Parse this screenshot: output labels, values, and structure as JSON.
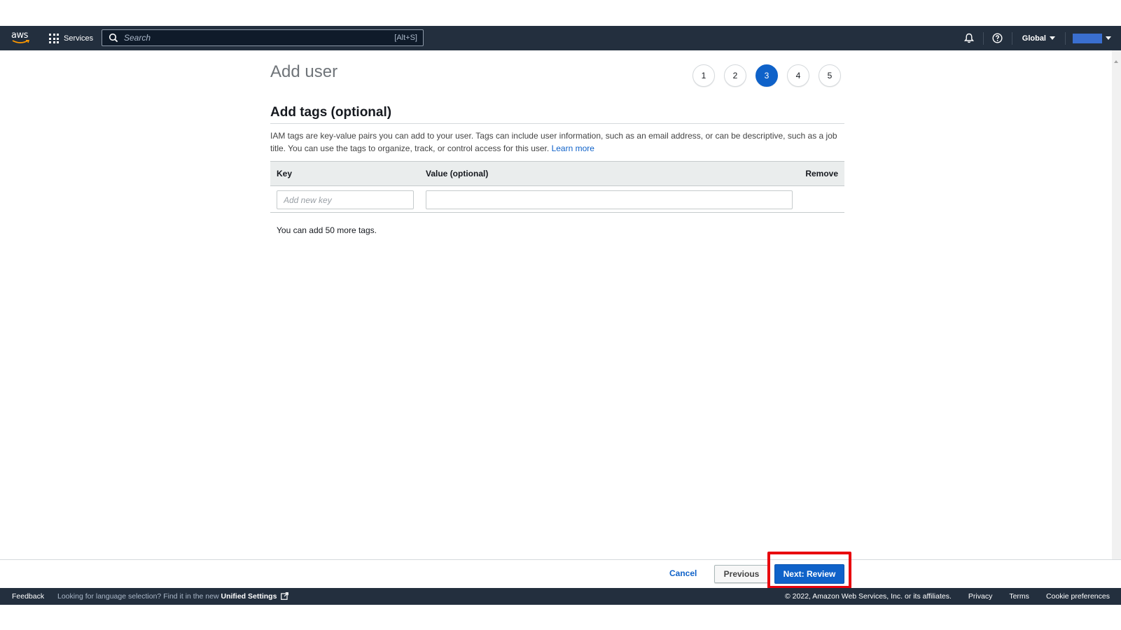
{
  "nav": {
    "logo_text": "aws",
    "services_label": "Services",
    "search_placeholder": "Search",
    "search_shortcut": "[Alt+S]",
    "region_label": "Global",
    "account_color": "#3a6fd0",
    "icons": [
      "bell-icon",
      "help-icon"
    ]
  },
  "page": {
    "title": "Add user",
    "steps": [
      "1",
      "2",
      "3",
      "4",
      "5"
    ],
    "active_step": "3",
    "section_title": "Add tags (optional)",
    "description": "IAM tags are key-value pairs you can add to your user. Tags can include user information, such as an email address, or can be descriptive, such as a job title. You can use the tags to organize, track, or control access for this user.",
    "learn_more": "Learn more",
    "table": {
      "col_key": "Key",
      "col_value": "Value (optional)",
      "col_remove": "Remove",
      "key_placeholder": "Add new key",
      "value": ""
    },
    "tags_remaining": "You can add 50 more tags."
  },
  "actions": {
    "cancel": "Cancel",
    "previous": "Previous",
    "next": "Next: Review"
  },
  "footer": {
    "feedback": "Feedback",
    "language_note": "Looking for language selection? Find it in the new",
    "unified_settings": "Unified Settings",
    "copyright": "© 2022, Amazon Web Services, Inc. or its affiliates.",
    "privacy": "Privacy",
    "terms": "Terms",
    "cookie_preferences": "Cookie preferences"
  },
  "colors": {
    "nav_bg": "#232f3e",
    "primary": "#0f62c9",
    "highlight": "#e8000d"
  }
}
